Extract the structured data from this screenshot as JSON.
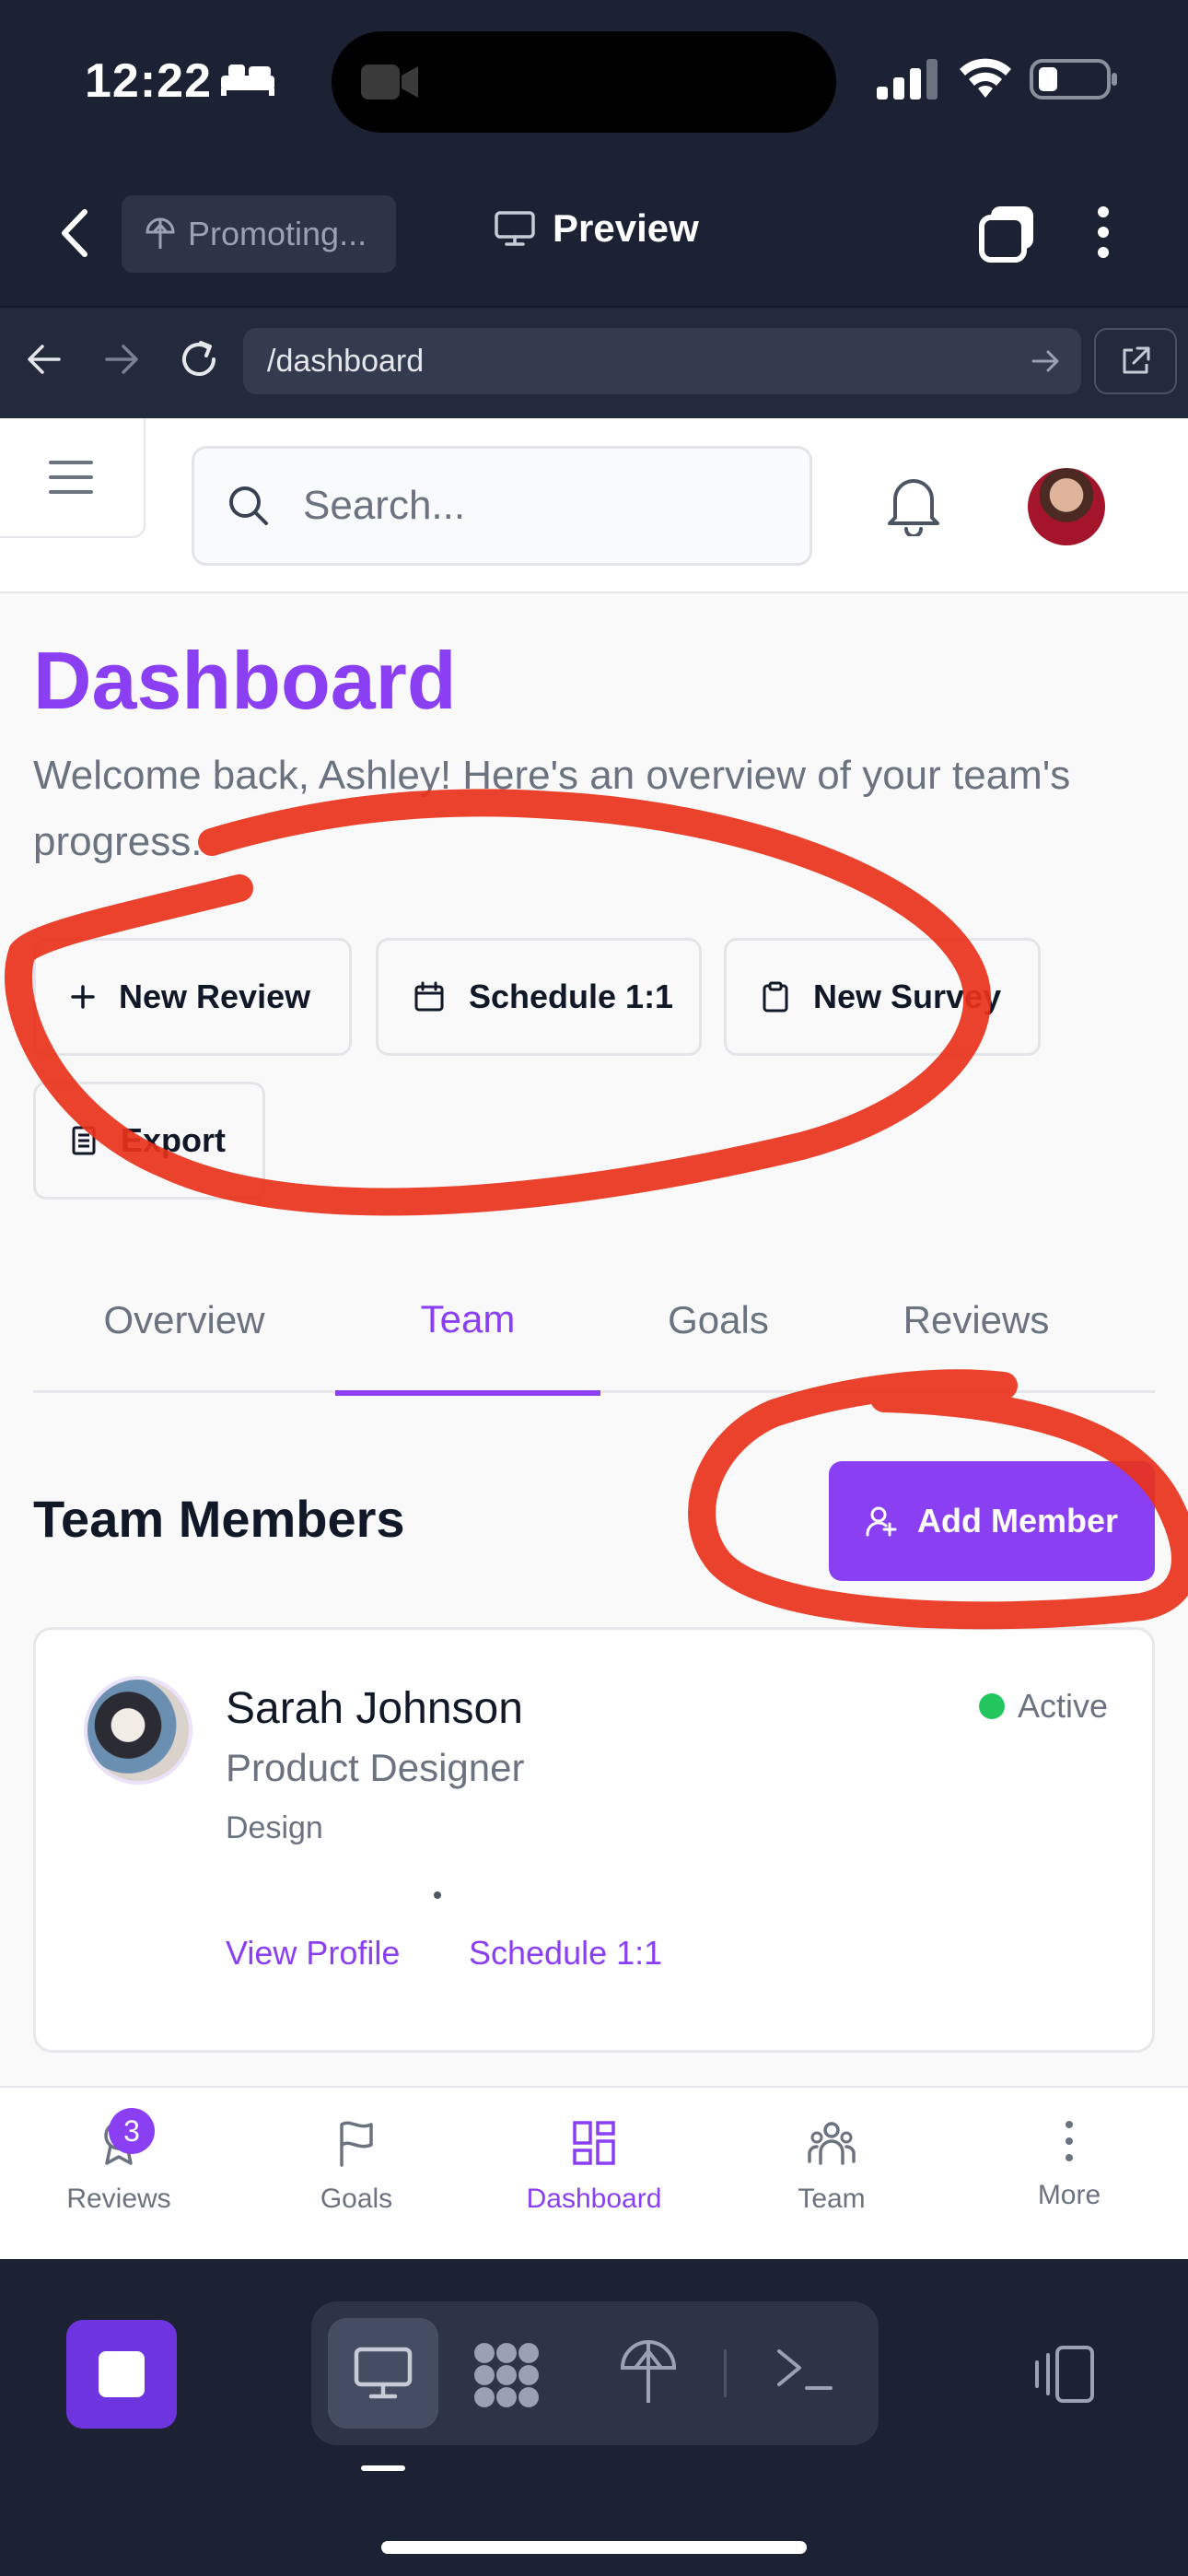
{
  "status_bar": {
    "time": "12:22"
  },
  "toolbar": {
    "project_label": "Promoting...",
    "title": "Preview"
  },
  "browser": {
    "url": "/dashboard"
  },
  "header": {
    "search_placeholder": "Search..."
  },
  "page": {
    "title": "Dashboard",
    "welcome": "Welcome back, Ashley! Here's an overview of your team's progress."
  },
  "actions": [
    {
      "label": "New Review",
      "icon": "plus-icon"
    },
    {
      "label": "Schedule 1:1",
      "icon": "calendar-icon"
    },
    {
      "label": "New Survey",
      "icon": "clipboard-icon"
    },
    {
      "label": "Export",
      "icon": "document-icon"
    }
  ],
  "tabs": [
    {
      "label": "Overview"
    },
    {
      "label": "Team",
      "active": true
    },
    {
      "label": "Goals"
    },
    {
      "label": "Reviews"
    }
  ],
  "team_section": {
    "title": "Team Members",
    "add_button": "Add Member",
    "members": [
      {
        "name": "Sarah Johnson",
        "role": "Product Designer",
        "department": "Design",
        "status": "Active",
        "links": [
          "View Profile",
          "Schedule 1:1"
        ]
      }
    ]
  },
  "bottom_nav": [
    {
      "label": "Reviews",
      "icon": "award-icon",
      "badge": "3"
    },
    {
      "label": "Goals",
      "icon": "flag-icon"
    },
    {
      "label": "Dashboard",
      "icon": "dashboard-icon",
      "active": true
    },
    {
      "label": "Team",
      "icon": "team-icon"
    },
    {
      "label": "More",
      "icon": "more-vertical-icon"
    }
  ],
  "colors": {
    "accent": "#8b3ff2",
    "status_active": "#22c55e",
    "annotation_red": "#e8321a",
    "chrome_dark": "#1c2233"
  }
}
